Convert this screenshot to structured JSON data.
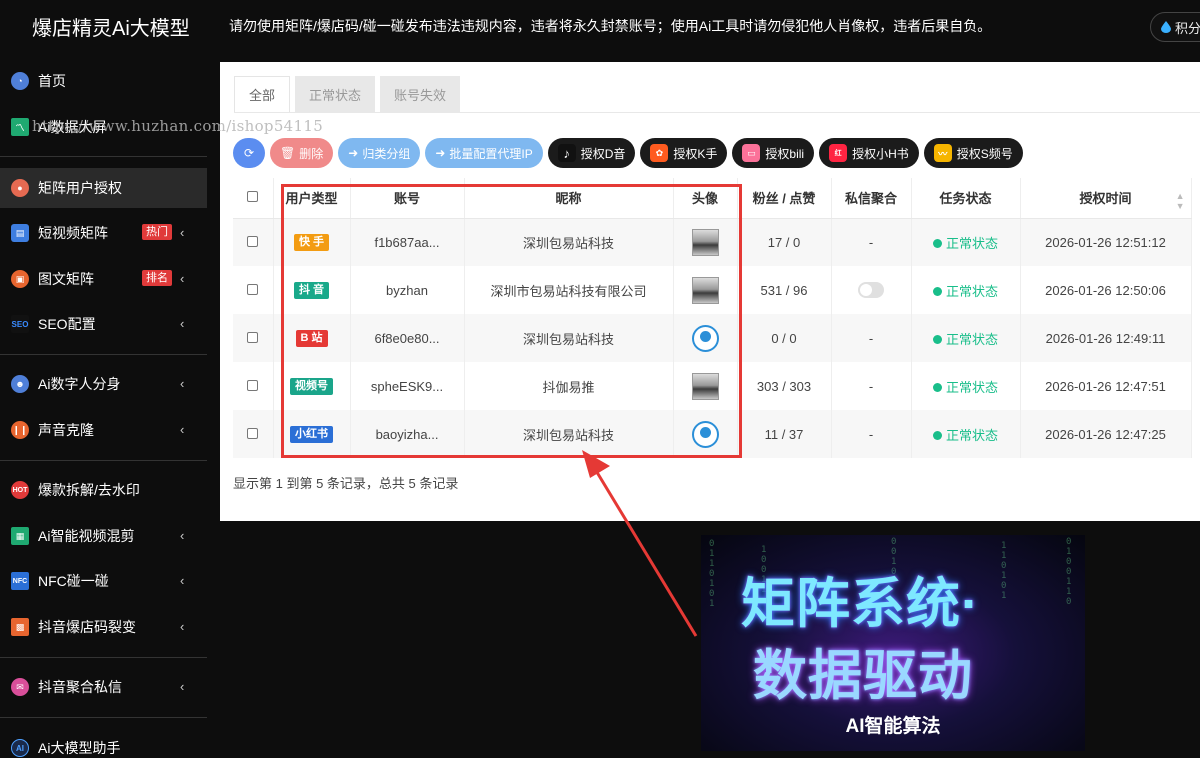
{
  "app": {
    "title": "爆店精灵Ai大模型",
    "notice": "请勿使用矩阵/爆店码/碰一碰发布违法违规内容，违者将永久封禁账号；使用Ai工具时请勿侵犯他人肖像权，违者后果自负。",
    "points_label": "积分"
  },
  "watermark": "https://www.huzhan.com/ishop54115",
  "sidebar": {
    "items": [
      {
        "label": "首页",
        "icon": "pie-chart-icon",
        "color": "#4f7fd8"
      },
      {
        "label": "Ai数据大屏",
        "icon": "line-chart-icon",
        "color": "#1fa971"
      },
      {
        "label": "矩阵用户授权",
        "icon": "users-icon",
        "color": "#e56a52"
      },
      {
        "label": "短视频矩阵",
        "icon": "video-icon",
        "color": "#3e7ee0",
        "badge": "热门"
      },
      {
        "label": "图文矩阵",
        "icon": "image-icon",
        "color": "#e7652f",
        "badge": "排名"
      },
      {
        "label": "SEO配置",
        "icon": "seo-icon",
        "color": "#2b6fd6"
      },
      {
        "label": "Ai数字人分身",
        "icon": "digital-human-icon",
        "color": "#4f7fd8"
      },
      {
        "label": "声音克隆",
        "icon": "audio-wave-icon",
        "color": "#e7652f"
      },
      {
        "label": "爆款拆解/去水印",
        "icon": "hot-icon",
        "color": "#e03a3a"
      },
      {
        "label": "Ai智能视频混剪",
        "icon": "clapper-icon",
        "color": "#1fa971"
      },
      {
        "label": "NFC碰一碰",
        "icon": "nfc-icon",
        "color": "#2b6fd6"
      },
      {
        "label": "抖音爆店码裂变",
        "icon": "qr-code-icon",
        "color": "#e7652f"
      },
      {
        "label": "抖音聚合私信",
        "icon": "message-icon",
        "color": "#d94f9a"
      },
      {
        "label": "Ai大模型助手",
        "icon": "ai-icon",
        "color": "#2b6fd6"
      }
    ]
  },
  "tabs": [
    "全部",
    "正常状态",
    "账号失效"
  ],
  "toolbar": {
    "delete": "删除",
    "group": "归类分组",
    "proxy": "批量配置代理IP",
    "auth_douyin": "授权D音",
    "auth_kuaishou": "授权K手",
    "auth_bili": "授权bili",
    "auth_xhs": "授权小H书",
    "auth_sph": "授权S频号"
  },
  "table": {
    "headers": [
      "用户类型",
      "账号",
      "昵称",
      "头像",
      "粉丝 / 点赞",
      "私信聚合",
      "任务状态",
      "授权时间"
    ],
    "rows": [
      {
        "type": "快 手",
        "type_color": "#f39c12",
        "account": "f1b687aa...",
        "nickname": "深圳包易站科技",
        "avatar": "photo",
        "stats": "17 / 0",
        "dm": "-",
        "status": "正常状态",
        "time": "2026-01-26 12:51:12"
      },
      {
        "type": "抖 音",
        "type_color": "#19a98a",
        "account": "byzhan",
        "nickname": "深圳市包易站科技有限公司",
        "avatar": "photo",
        "stats": "531 / 96",
        "dm": "toggle",
        "status": "正常状态",
        "time": "2026-01-26 12:50:06"
      },
      {
        "type": "B 站",
        "type_color": "#e53935",
        "account": "6f8e0e80...",
        "nickname": "深圳包易站科技",
        "avatar": "logo",
        "stats": "0 / 0",
        "dm": "-",
        "status": "正常状态",
        "time": "2026-01-26 12:49:11"
      },
      {
        "type": "视频号",
        "type_color": "#1aa58a",
        "account": "spheESK9...",
        "nickname": "抖伽易推",
        "avatar": "photo",
        "stats": "303 / 303",
        "dm": "-",
        "status": "正常状态",
        "time": "2026-01-26 12:47:51"
      },
      {
        "type": "小红书",
        "type_color": "#2b6fd6",
        "account": "baoyizha...",
        "nickname": "深圳包易站科技",
        "avatar": "logo",
        "stats": "11 / 37",
        "dm": "-",
        "status": "正常状态",
        "time": "2026-01-26 12:47:25"
      }
    ]
  },
  "pager_info": "显示第 1 到第 5 条记录，总共 5 条记录",
  "promo": {
    "line1": "矩阵系统·",
    "line2": "数据驱动",
    "line3": "AI智能算法"
  }
}
